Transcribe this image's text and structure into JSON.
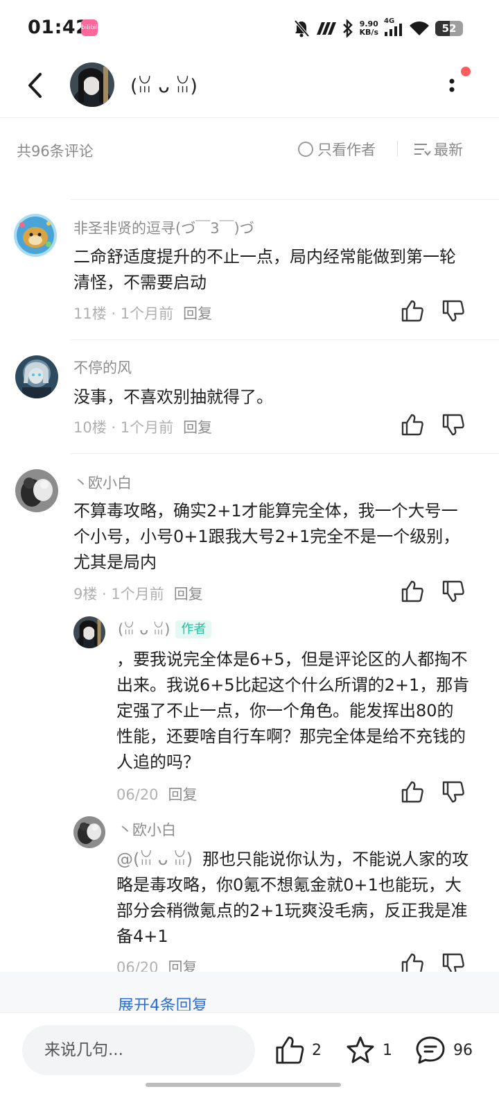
{
  "status_bar": {
    "time": "01:42",
    "app_badge": "bilibili",
    "net_speed_value": "9.90",
    "net_speed_unit": "KB/s",
    "network": "4G",
    "battery": "52",
    "icons": [
      "bell-off-icon",
      "signal-strength-icon",
      "bluetooth-icon",
      "cellular-signal-icon",
      "wifi-icon",
      "battery-icon"
    ]
  },
  "nav": {
    "title": "(ꈍ ᴗ ꈍ)",
    "icons": [
      "back-arrow-icon",
      "more-icon"
    ]
  },
  "filter": {
    "count_label": "共96条评论",
    "author_only_label": "只看作者",
    "sort_label": "最新"
  },
  "comments": [
    {
      "username": "非圣非贤的逗寻(づ￣3￣)づ",
      "content": "二命舒适度提升的不止一点，局内经常能做到第一轮清怪，不需要启动",
      "meta": "11楼 · 1个月前",
      "reply_label": "回复"
    },
    {
      "username": "不停的风",
      "content": "没事，不喜欢别抽就得了。",
      "meta": "10楼 · 1个月前",
      "reply_label": "回复"
    },
    {
      "username": "丶欧小白",
      "content": "不算毒攻略，确实2+1才能算完全体，我一个大号一个小号，小号0+1跟我大号2+1完全不是一个级别，尤其是局内",
      "meta": "9楼 · 1个月前",
      "reply_label": "回复"
    }
  ],
  "replies": [
    {
      "username": "(ꈍ ᴗ ꈍ)",
      "author_tag": "作者",
      "content": "，要我说完全体是6+5，但是评论区的人都掏不出来。我说6+5比起这个什么所谓的2+1，那肯定强了不止一点，你一个角色。能发挥出80的性能，还要啥自行车啊？那完全体是给不充钱的人追的吗？",
      "meta": "06/20",
      "reply_label": "回复"
    },
    {
      "username": "丶欧小白",
      "mention": "@(ꈍ ᴗ ꈍ)",
      "content": "那也只能说你认为，不能说人家的攻略是毒攻略，你0氪不想氪金就0+1也能玩，大部分会稍微氪点的2+1玩爽没毛病，反正我是准备4+1",
      "meta": "06/20",
      "reply_label": "回复"
    }
  ],
  "expand_replies_label": "展开4条回复",
  "bottom_bar": {
    "input_placeholder": "来说几句...",
    "like_count": "2",
    "favorite_count": "1",
    "comment_count": "96"
  }
}
